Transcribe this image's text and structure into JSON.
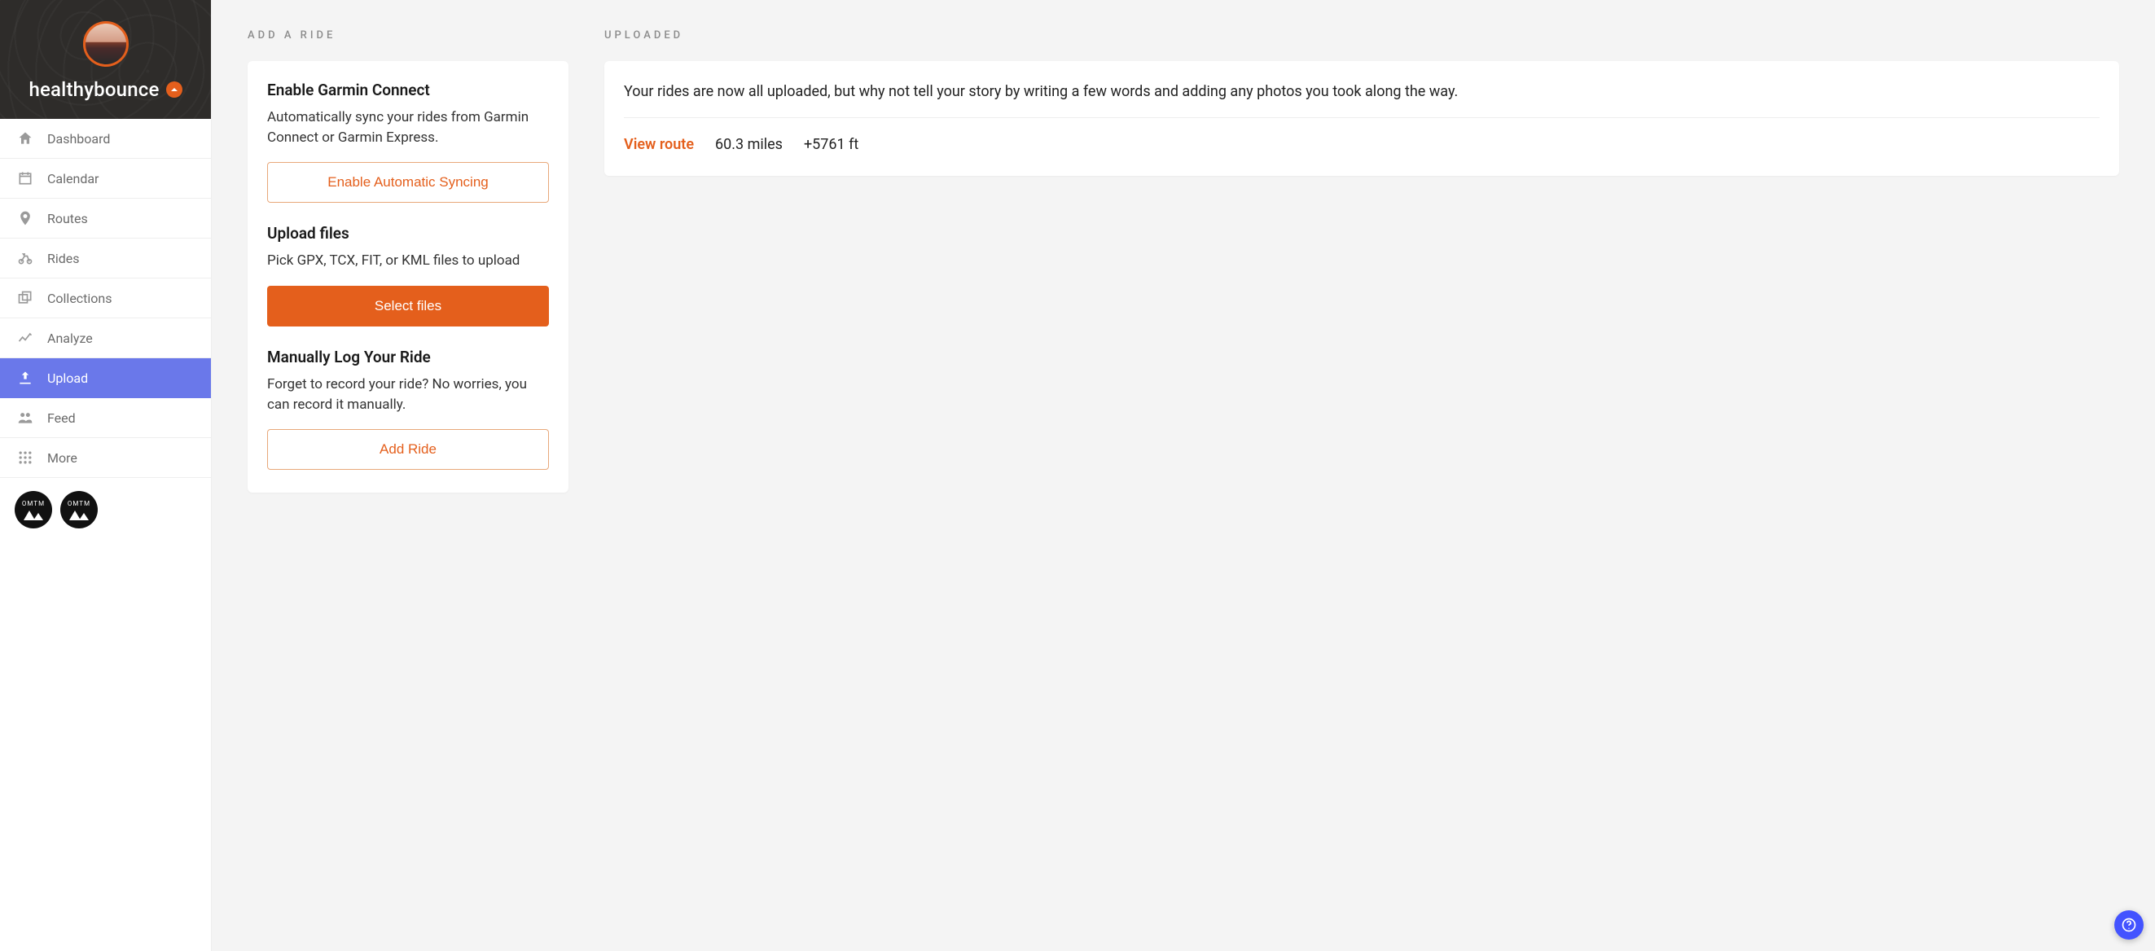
{
  "user": {
    "name": "healthybounce"
  },
  "nav": {
    "items": [
      {
        "label": "Dashboard",
        "icon": "home-icon"
      },
      {
        "label": "Calendar",
        "icon": "calendar-icon"
      },
      {
        "label": "Routes",
        "icon": "pin-icon"
      },
      {
        "label": "Rides",
        "icon": "bike-icon"
      },
      {
        "label": "Collections",
        "icon": "collections-icon"
      },
      {
        "label": "Analyze",
        "icon": "chart-icon"
      },
      {
        "label": "Upload",
        "icon": "upload-icon"
      },
      {
        "label": "Feed",
        "icon": "people-icon"
      },
      {
        "label": "More",
        "icon": "grid-icon"
      }
    ],
    "active_index": 6
  },
  "clubs": [
    "OMTM",
    "OMTM"
  ],
  "add_ride": {
    "section_label": "ADD A RIDE",
    "garmin": {
      "title": "Enable Garmin Connect",
      "desc": "Automatically sync your rides from Garmin Connect or Garmin Express.",
      "button": "Enable Automatic Syncing"
    },
    "upload": {
      "title": "Upload files",
      "desc": "Pick GPX, TCX, FIT, or KML files to upload",
      "button": "Select files"
    },
    "manual": {
      "title": "Manually Log Your Ride",
      "desc": "Forget to record your ride? No worries, you can record it manually.",
      "button": "Add Ride"
    }
  },
  "uploaded": {
    "section_label": "UPLOADED",
    "message": "Your rides are now all uploaded, but why not tell your story by writing a few words and adding any photos you took along the way.",
    "view_route_label": "View route",
    "distance": "60.3 miles",
    "elevation": "+5761 ft"
  },
  "colors": {
    "accent": "#e45f1c",
    "nav_active": "#6a78ea",
    "help": "#4353ff"
  }
}
